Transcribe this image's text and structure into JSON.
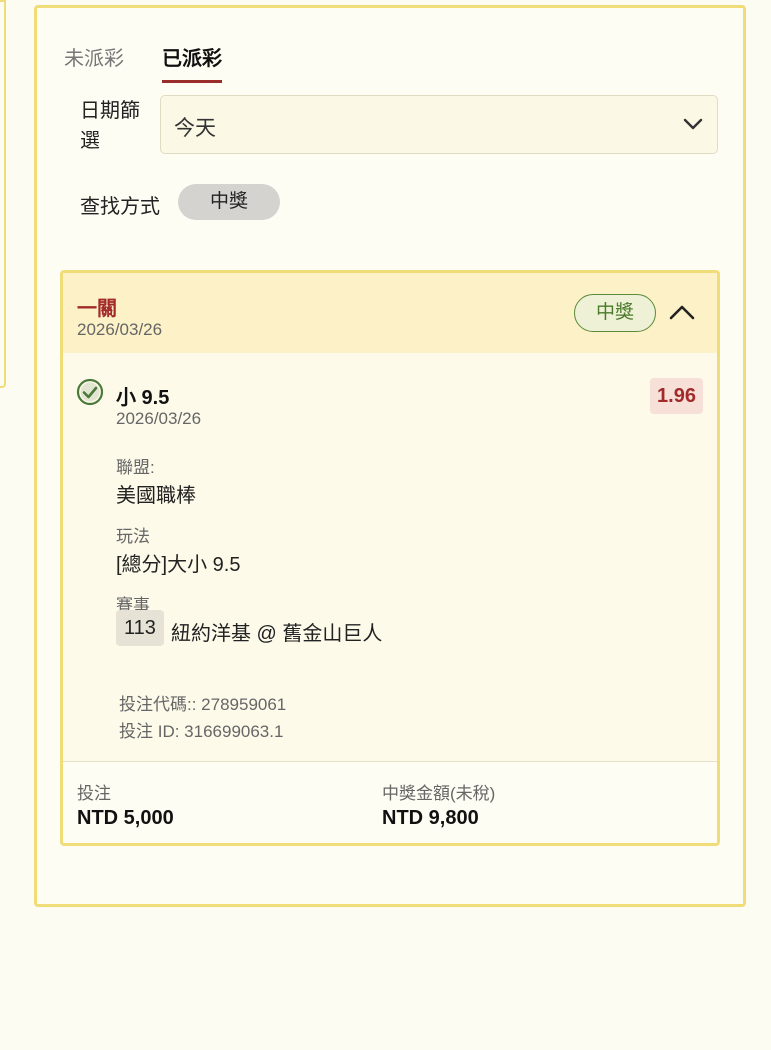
{
  "tabs": [
    {
      "label": "未派彩"
    },
    {
      "label": "已派彩"
    }
  ],
  "filters": {
    "date_label": "日期篩選",
    "date_value": "今天",
    "search_label": "查找方式",
    "search_chip": "中獎"
  },
  "bet": {
    "type": "一關",
    "date": "2026/03/26",
    "status": "中獎",
    "selection": {
      "name": "小 9.5",
      "date": "2026/03/26",
      "odds": "1.96",
      "league_label": "聯盟:",
      "league": "美國職棒",
      "market_label": "玩法",
      "market": "[總分]大小 9.5",
      "event_label": "賽事",
      "event_code": "113",
      "event_name": "紐約洋基 @ 舊金山巨人"
    },
    "bet_code_line": "投注代碼:: 278959061",
    "bet_id_line": "投注 ID: 316699063.1",
    "stake_label": "投注",
    "stake": "NTD 5,000",
    "payout_label": "中獎金額(未稅)",
    "payout": "NTD 9,800"
  },
  "colors": {
    "accent": "#a22a2a",
    "border": "#f1dc7a",
    "win_green": "#4a7a2a"
  }
}
